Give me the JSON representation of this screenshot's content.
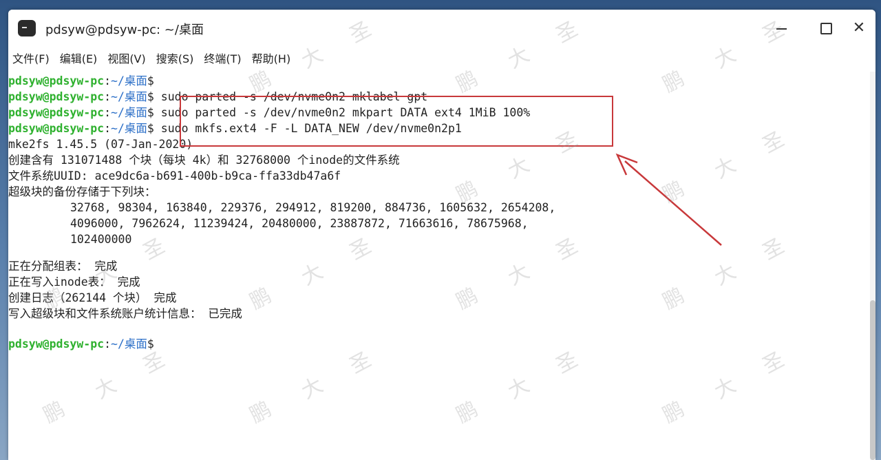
{
  "window": {
    "title": "pdsyw@pdsyw-pc: ~/桌面"
  },
  "icons": {
    "app": "terminal-app-icon",
    "minimize": "minimize-icon",
    "maximize": "maximize-icon",
    "close": "close-icon",
    "close_glyph": "✕"
  },
  "menu": [
    "文件(F)",
    "编辑(E)",
    "视图(V)",
    "搜索(S)",
    "终端(T)",
    "帮助(H)"
  ],
  "prompt": {
    "user": "pdsyw@pdsyw-pc",
    "sep": ":",
    "path": "~/桌面",
    "dollar": "$"
  },
  "commands": [
    "sudo parted -s /dev/nvme0n2 mklabel gpt",
    "sudo parted -s /dev/nvme0n2 mkpart DATA ext4 1MiB 100%",
    "sudo mkfs.ext4 -F -L DATA_NEW /dev/nvme0n2p1"
  ],
  "output": [
    "mke2fs 1.45.5 (07-Jan-2020)",
    "创建含有 131071488 个块（每块 4k）和 32768000 个inode的文件系统",
    "文件系统UUID: ace9dc6a-b691-400b-b9ca-ffa33db47a6f",
    "超级块的备份存储于下列块：",
    "32768, 98304, 163840, 229376, 294912, 819200, 884736, 1605632, 2654208,",
    "4096000, 7962624, 11239424, 20480000, 23887872, 71663616, 78675968,",
    "102400000",
    "正在分配组表： 完成",
    "正在写入inode表： 完成",
    "创建日志（262144 个块） 完成",
    "写入超级块和文件系统账户统计信息： 已完成"
  ],
  "watermark": [
    "鹏",
    "大",
    "圣"
  ],
  "colors": {
    "prompt_user": "#2fb12f",
    "prompt_path": "#2a6ec7",
    "annotation": "#c8383a"
  }
}
